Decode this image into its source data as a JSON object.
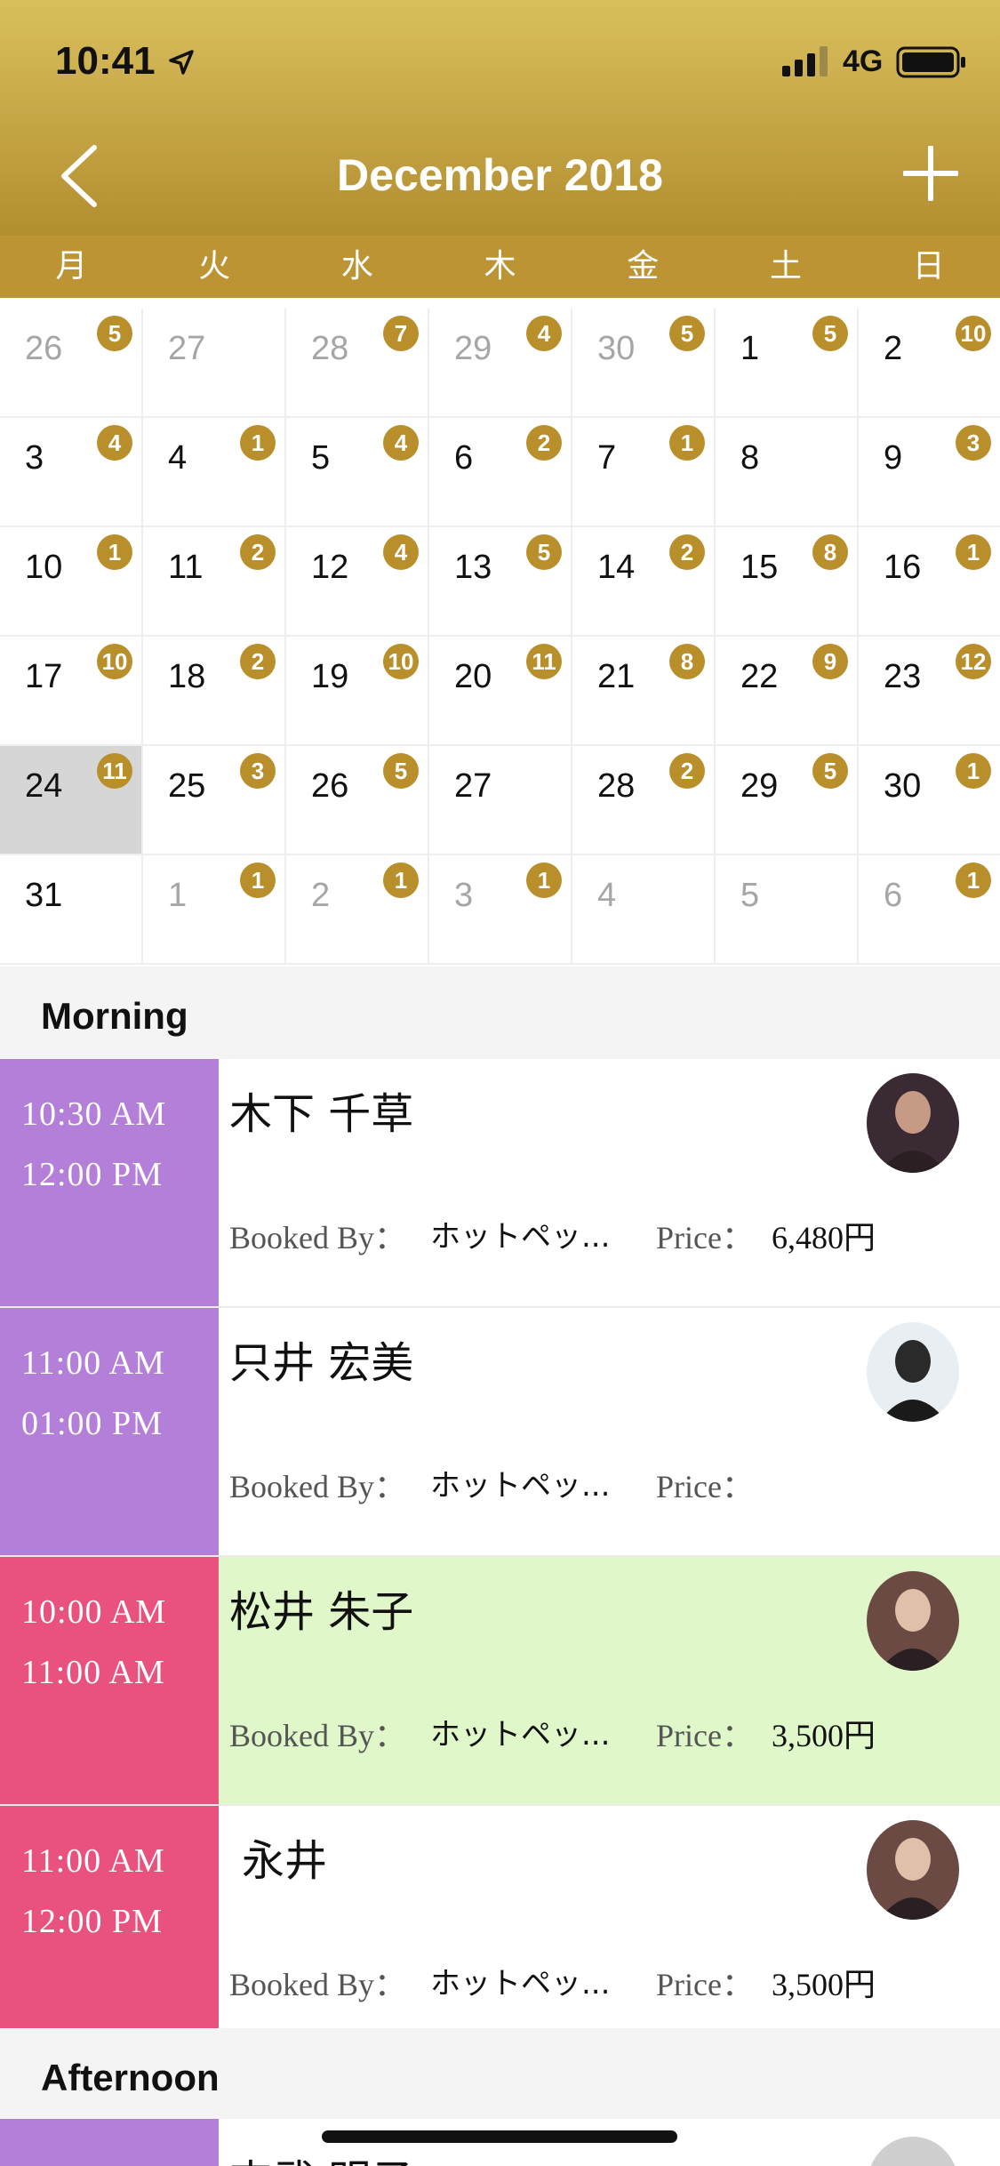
{
  "status_bar": {
    "time": "10:41",
    "network": "4G"
  },
  "header": {
    "title": "December 2018"
  },
  "weekdays": [
    "月",
    "火",
    "水",
    "木",
    "金",
    "土",
    "日"
  ],
  "calendar": [
    [
      {
        "day": "26",
        "badge": "5",
        "other": true
      },
      {
        "day": "27",
        "badge": "",
        "other": true
      },
      {
        "day": "28",
        "badge": "7",
        "other": true
      },
      {
        "day": "29",
        "badge": "4",
        "other": true
      },
      {
        "day": "30",
        "badge": "5",
        "other": true
      },
      {
        "day": "1",
        "badge": "5"
      },
      {
        "day": "2",
        "badge": "10"
      }
    ],
    [
      {
        "day": "3",
        "badge": "4"
      },
      {
        "day": "4",
        "badge": "1"
      },
      {
        "day": "5",
        "badge": "4"
      },
      {
        "day": "6",
        "badge": "2"
      },
      {
        "day": "7",
        "badge": "1"
      },
      {
        "day": "8",
        "badge": ""
      },
      {
        "day": "9",
        "badge": "3"
      }
    ],
    [
      {
        "day": "10",
        "badge": "1"
      },
      {
        "day": "11",
        "badge": "2"
      },
      {
        "day": "12",
        "badge": "4"
      },
      {
        "day": "13",
        "badge": "5"
      },
      {
        "day": "14",
        "badge": "2"
      },
      {
        "day": "15",
        "badge": "8"
      },
      {
        "day": "16",
        "badge": "1"
      }
    ],
    [
      {
        "day": "17",
        "badge": "10"
      },
      {
        "day": "18",
        "badge": "2"
      },
      {
        "day": "19",
        "badge": "10"
      },
      {
        "day": "20",
        "badge": "11"
      },
      {
        "day": "21",
        "badge": "8"
      },
      {
        "day": "22",
        "badge": "9"
      },
      {
        "day": "23",
        "badge": "12"
      }
    ],
    [
      {
        "day": "24",
        "badge": "11",
        "selected": true
      },
      {
        "day": "25",
        "badge": "3"
      },
      {
        "day": "26",
        "badge": "5"
      },
      {
        "day": "27",
        "badge": ""
      },
      {
        "day": "28",
        "badge": "2"
      },
      {
        "day": "29",
        "badge": "5"
      },
      {
        "day": "30",
        "badge": "1"
      }
    ],
    [
      {
        "day": "31",
        "badge": ""
      },
      {
        "day": "1",
        "badge": "1",
        "other": true
      },
      {
        "day": "2",
        "badge": "1",
        "other": true
      },
      {
        "day": "3",
        "badge": "1",
        "other": true
      },
      {
        "day": "4",
        "badge": "",
        "other": true
      },
      {
        "day": "5",
        "badge": "",
        "other": true
      },
      {
        "day": "6",
        "badge": "1",
        "other": true
      }
    ]
  ],
  "sections": {
    "morning": "Morning",
    "afternoon": "Afternoon"
  },
  "labels": {
    "booked_by": "Booked By：",
    "price": "Price："
  },
  "appointments": [
    {
      "start": "10:30 AM",
      "end": "12:00 PM",
      "name": "木下 千草",
      "booked_by": "ホットペッ...",
      "price": "6,480円",
      "color": "#b37fd8"
    },
    {
      "start": "11:00 AM",
      "end": "01:00 PM",
      "name": "只井 宏美",
      "booked_by": "ホットペッ...",
      "price": "",
      "color": "#b37fd8"
    },
    {
      "start": "10:00 AM",
      "end": "11:00 AM",
      "name": "松井 朱子",
      "booked_by": "ホットペッ...",
      "price": "3,500円",
      "color": "#e9527f",
      "highlight": true
    },
    {
      "start": "11:00 AM",
      "end": "12:00 PM",
      "name": "永井",
      "booked_by": "ホットペッ...",
      "price": "3,500円",
      "color": "#e9527f"
    }
  ],
  "partial_appointment": {
    "name": "吉武 明子",
    "color": "#b37fd8"
  },
  "colors": {
    "header_gold": "#c9a94a",
    "weekday_bar": "#bd9433",
    "badge": "#b98f2c",
    "purple": "#b37fd8",
    "pink": "#e9527f",
    "highlight": "#dff7c9"
  }
}
